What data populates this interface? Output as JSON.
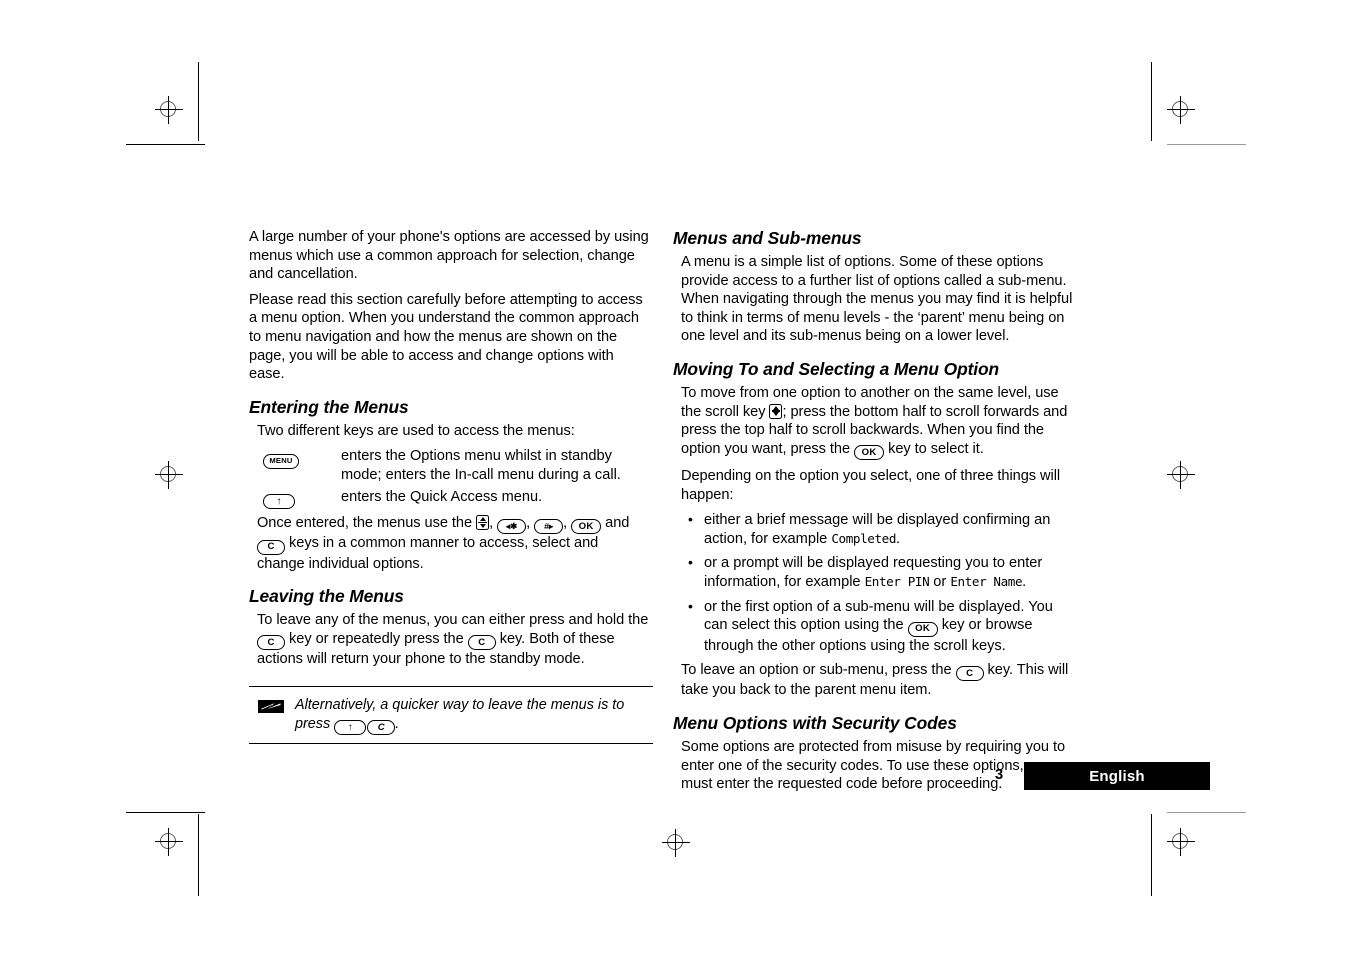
{
  "document": {
    "page_number": "3",
    "language_label": "English"
  },
  "left_column": {
    "intro_paragraphs": [
      "A large number of your phone's options are accessed by using menus which use a common approach for selection, change and cancellation.",
      "Please read this section carefully before attempting to access a menu option. When you understand the common approach to menu navigation and how the menus are shown on the page, you will be able to access and change options with ease."
    ],
    "entering_heading": "Entering the Menus",
    "entering_intro": "Two different keys are used to access the menus:",
    "key_definitions": [
      {
        "key_icon": "menu-key-icon",
        "key_label": "MENU",
        "description": "enters the Options menu whilst in standby mode; enters the In-call menu during a call."
      },
      {
        "key_icon": "up-arrow-key-icon",
        "key_label": "↑",
        "description": "enters the Quick Access menu."
      }
    ],
    "once_entered": {
      "part1": "Once entered, the menus use the ",
      "sep": ", ",
      "and": " and ",
      "part2": " keys in a common manner to access, select and change individual options."
    },
    "leaving_heading": "Leaving the Menus",
    "leaving": {
      "part1": "To leave any of the menus, you can either press and hold the ",
      "part2": " key or repeatedly press the ",
      "part3": " key. Both of these actions will return your phone to the standby mode."
    },
    "note": {
      "icon": "motorola-bolt-icon",
      "part1": "Alternatively, a quicker way to leave the menus is to press ",
      "part2": "."
    }
  },
  "right_column": {
    "menus_heading": "Menus and Sub-menus",
    "menus_paragraph": "A menu is a simple list of options. Some of these options provide access to a further list of options called a sub-menu. When navigating through the menus you may find it is helpful to think in terms of menu levels - the ‘parent’ menu being on one level and its sub-menus being on a lower level.",
    "moving_heading": "Moving To and Selecting a Menu Option",
    "moving": {
      "part1": "To move from one option to another on the same level, use the scroll key ",
      "part2": "; press the bottom half to scroll forwards and press the top half to scroll backwards. When you find the option you want, press the ",
      "part3": " key to select it."
    },
    "depending_paragraph": "Depending on the option you select, one of three things will happen:",
    "bullets": [
      {
        "part1": "either a brief message will be displayed confirming an action, for example ",
        "mono1": "Completed",
        "part2": "."
      },
      {
        "part1": "or a prompt will be displayed requesting you to enter information, for example ",
        "mono1": "Enter PIN",
        "part2": " or ",
        "mono2": "Enter Name",
        "part3": "."
      },
      {
        "part1": "or the first option of a sub-menu will be displayed. You can select this option using the ",
        "part2": " key or browse through the other options using the scroll keys."
      }
    ],
    "leave_option": {
      "part1": "To leave an option or sub-menu, press the ",
      "part2": " key. This will take you back to the parent menu item."
    },
    "security_heading": "Menu Options with Security Codes",
    "security_paragraph": "Some options are protected from misuse by requiring you to enter one of the security codes. To use these options, you must enter the requested code before proceeding."
  },
  "key_glyphs": {
    "menu": "MENU",
    "up": "↑",
    "ok": "OK",
    "clear": "C",
    "star": "◂✱",
    "hash": "#▸"
  },
  "colors": {
    "ink": "#000000",
    "paper": "#ffffff",
    "regmark": "#5a5a5a"
  }
}
